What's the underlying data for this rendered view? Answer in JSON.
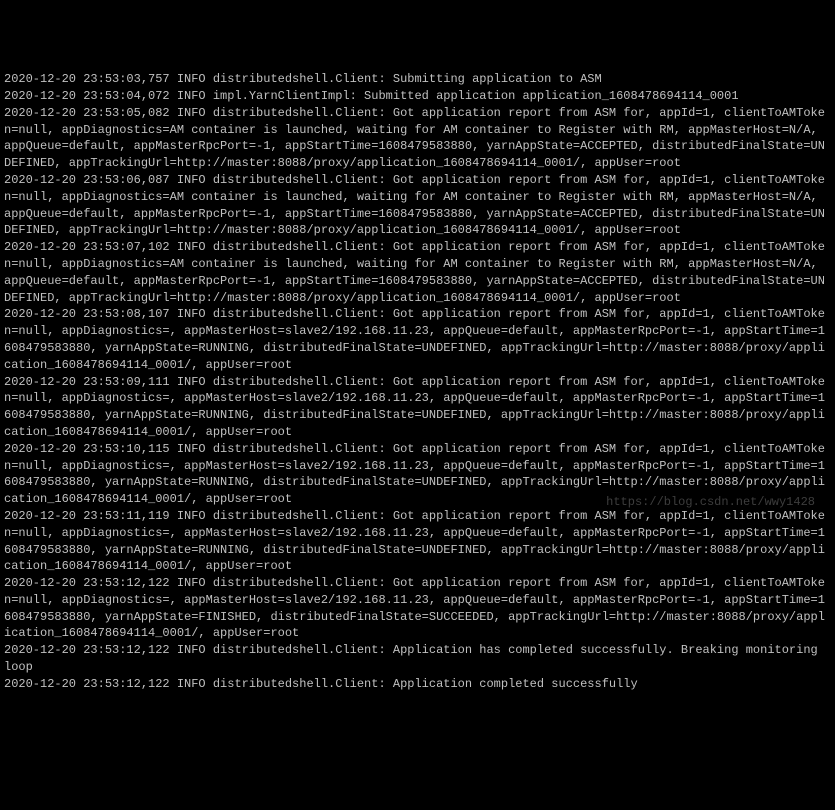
{
  "lines": [
    "2020-12-20 23:53:03,757 INFO distributedshell.Client: Submitting application to ASM",
    "2020-12-20 23:53:04,072 INFO impl.YarnClientImpl: Submitted application application_1608478694114_0001",
    "2020-12-20 23:53:05,082 INFO distributedshell.Client: Got application report from ASM for, appId=1, clientToAMToken=null, appDiagnostics=AM container is launched, waiting for AM container to Register with RM, appMasterHost=N/A, appQueue=default, appMasterRpcPort=-1, appStartTime=1608479583880, yarnAppState=ACCEPTED, distributedFinalState=UNDEFINED, appTrackingUrl=http://master:8088/proxy/application_1608478694114_0001/, appUser=root",
    "2020-12-20 23:53:06,087 INFO distributedshell.Client: Got application report from ASM for, appId=1, clientToAMToken=null, appDiagnostics=AM container is launched, waiting for AM container to Register with RM, appMasterHost=N/A, appQueue=default, appMasterRpcPort=-1, appStartTime=1608479583880, yarnAppState=ACCEPTED, distributedFinalState=UNDEFINED, appTrackingUrl=http://master:8088/proxy/application_1608478694114_0001/, appUser=root",
    "2020-12-20 23:53:07,102 INFO distributedshell.Client: Got application report from ASM for, appId=1, clientToAMToken=null, appDiagnostics=AM container is launched, waiting for AM container to Register with RM, appMasterHost=N/A, appQueue=default, appMasterRpcPort=-1, appStartTime=1608479583880, yarnAppState=ACCEPTED, distributedFinalState=UNDEFINED, appTrackingUrl=http://master:8088/proxy/application_1608478694114_0001/, appUser=root",
    "2020-12-20 23:53:08,107 INFO distributedshell.Client: Got application report from ASM for, appId=1, clientToAMToken=null, appDiagnostics=, appMasterHost=slave2/192.168.11.23, appQueue=default, appMasterRpcPort=-1, appStartTime=1608479583880, yarnAppState=RUNNING, distributedFinalState=UNDEFINED, appTrackingUrl=http://master:8088/proxy/application_1608478694114_0001/, appUser=root",
    "2020-12-20 23:53:09,111 INFO distributedshell.Client: Got application report from ASM for, appId=1, clientToAMToken=null, appDiagnostics=, appMasterHost=slave2/192.168.11.23, appQueue=default, appMasterRpcPort=-1, appStartTime=1608479583880, yarnAppState=RUNNING, distributedFinalState=UNDEFINED, appTrackingUrl=http://master:8088/proxy/application_1608478694114_0001/, appUser=root",
    "2020-12-20 23:53:10,115 INFO distributedshell.Client: Got application report from ASM for, appId=1, clientToAMToken=null, appDiagnostics=, appMasterHost=slave2/192.168.11.23, appQueue=default, appMasterRpcPort=-1, appStartTime=1608479583880, yarnAppState=RUNNING, distributedFinalState=UNDEFINED, appTrackingUrl=http://master:8088/proxy/application_1608478694114_0001/, appUser=root",
    "2020-12-20 23:53:11,119 INFO distributedshell.Client: Got application report from ASM for, appId=1, clientToAMToken=null, appDiagnostics=, appMasterHost=slave2/192.168.11.23, appQueue=default, appMasterRpcPort=-1, appStartTime=1608479583880, yarnAppState=RUNNING, distributedFinalState=UNDEFINED, appTrackingUrl=http://master:8088/proxy/application_1608478694114_0001/, appUser=root",
    "2020-12-20 23:53:12,122 INFO distributedshell.Client: Got application report from ASM for, appId=1, clientToAMToken=null, appDiagnostics=, appMasterHost=slave2/192.168.11.23, appQueue=default, appMasterRpcPort=-1, appStartTime=1608479583880, yarnAppState=FINISHED, distributedFinalState=SUCCEEDED, appTrackingUrl=http://master:8088/proxy/application_1608478694114_0001/, appUser=root",
    "2020-12-20 23:53:12,122 INFO distributedshell.Client: Application has completed successfully. Breaking monitoring loop",
    "2020-12-20 23:53:12,122 INFO distributedshell.Client: Application completed successfully"
  ],
  "watermark": "https://blog.csdn.net/wwy1428"
}
